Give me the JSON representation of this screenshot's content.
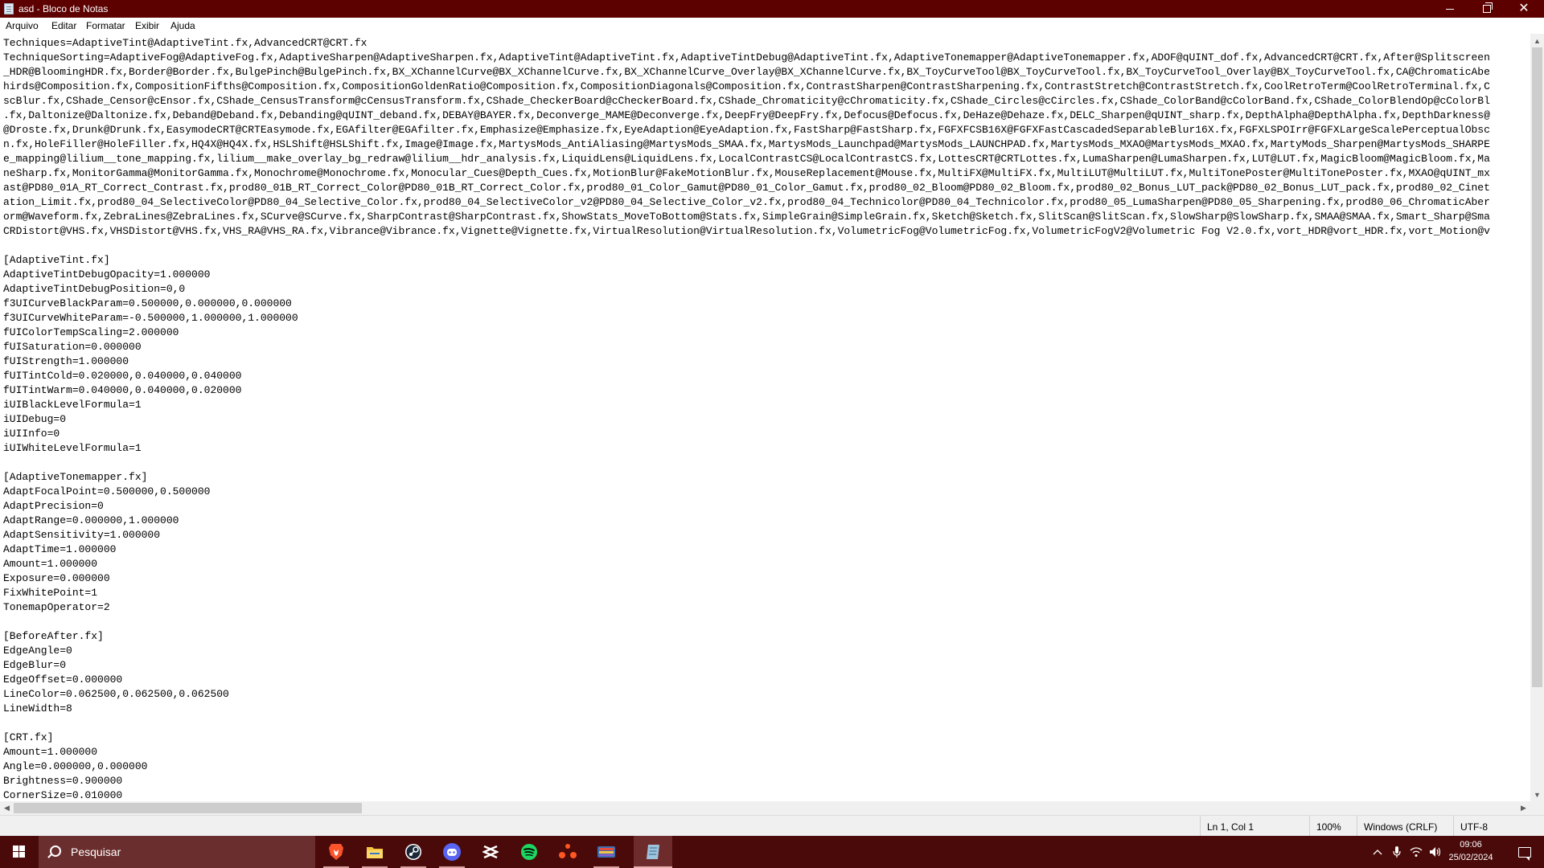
{
  "window": {
    "title": "asd - Bloco de Notas",
    "icon": "notepad-icon",
    "controls": [
      "minimize-icon",
      "maximize-icon",
      "close-icon"
    ]
  },
  "menu": {
    "items": [
      "Arquivo",
      "Editar",
      "Formatar",
      "Exibir",
      "Ajuda"
    ]
  },
  "document": {
    "lines": [
      "Techniques=AdaptiveTint@AdaptiveTint.fx,AdvancedCRT@CRT.fx",
      "TechniqueSorting=AdaptiveFog@AdaptiveFog.fx,AdaptiveSharpen@AdaptiveSharpen.fx,AdaptiveTint@AdaptiveTint.fx,AdaptiveTintDebug@AdaptiveTint.fx,AdaptiveTonemapper@AdaptiveTonemapper.fx,ADOF@qUINT_dof.fx,AdvancedCRT@CRT.fx,After@Splitscreen",
      "_HDR@BloomingHDR.fx,Border@Border.fx,BulgePinch@BulgePinch.fx,BX_XChannelCurve@BX_XChannelCurve.fx,BX_XChannelCurve_Overlay@BX_XChannelCurve.fx,BX_ToyCurveTool@BX_ToyCurveTool.fx,BX_ToyCurveTool_Overlay@BX_ToyCurveTool.fx,CA@ChromaticAbe",
      "hirds@Composition.fx,CompositionFifths@Composition.fx,CompositionGoldenRatio@Composition.fx,CompositionDiagonals@Composition.fx,ContrastSharpen@ContrastSharpening.fx,ContrastStretch@ContrastStretch.fx,CoolRetroTerm@CoolRetroTerminal.fx,C",
      "scBlur.fx,CShade_Censor@cEnsor.fx,CShade_CensusTransform@cCensusTransform.fx,CShade_CheckerBoard@cCheckerBoard.fx,CShade_Chromaticity@cChromaticity.fx,CShade_Circles@cCircles.fx,CShade_ColorBand@cColorBand.fx,CShade_ColorBlendOp@cColorBl",
      ".fx,Daltonize@Daltonize.fx,Deband@Deband.fx,Debanding@qUINT_deband.fx,DEBAY@BAYER.fx,Deconverge_MAME@Deconverge.fx,DeepFry@DeepFry.fx,Defocus@Defocus.fx,DeHaze@Dehaze.fx,DELC_Sharpen@qUINT_sharp.fx,DepthAlpha@DepthAlpha.fx,DepthDarkness@",
      "@Droste.fx,Drunk@Drunk.fx,EasymodeCRT@CRTEasymode.fx,EGAfilter@EGAfilter.fx,Emphasize@Emphasize.fx,EyeAdaption@EyeAdaption.fx,FastSharp@FastSharp.fx,FGFXFCSB16X@FGFXFastCascadedSeparableBlur16X.fx,FGFXLSPOIrr@FGFXLargeScalePerceptualObsc",
      "n.fx,HoleFiller@HoleFiller.fx,HQ4X@HQ4X.fx,HSLShift@HSLShift.fx,Image@Image.fx,MartysMods_AntiAliasing@MartysMods_SMAA.fx,MartysMods_Launchpad@MartysMods_LAUNCHPAD.fx,MartysMods_MXAO@MartysMods_MXAO.fx,MartyMods_Sharpen@MartysMods_SHARPE",
      "e_mapping@lilium__tone_mapping.fx,lilium__make_overlay_bg_redraw@lilium__hdr_analysis.fx,LiquidLens@LiquidLens.fx,LocalContrastCS@LocalContrastCS.fx,LottesCRT@CRTLottes.fx,LumaSharpen@LumaSharpen.fx,LUT@LUT.fx,MagicBloom@MagicBloom.fx,Ma",
      "neSharp.fx,MonitorGamma@MonitorGamma.fx,Monochrome@Monochrome.fx,Monocular_Cues@Depth_Cues.fx,MotionBlur@FakeMotionBlur.fx,MouseReplacement@Mouse.fx,MultiFX@MultiFX.fx,MultiLUT@MultiLUT.fx,MultiTonePoster@MultiTonePoster.fx,MXAO@qUINT_mx",
      "ast@PD80_01A_RT_Correct_Contrast.fx,prod80_01B_RT_Correct_Color@PD80_01B_RT_Correct_Color.fx,prod80_01_Color_Gamut@PD80_01_Color_Gamut.fx,prod80_02_Bloom@PD80_02_Bloom.fx,prod80_02_Bonus_LUT_pack@PD80_02_Bonus_LUT_pack.fx,prod80_02_Cinet",
      "ation_Limit.fx,prod80_04_SelectiveColor@PD80_04_Selective_Color.fx,prod80_04_SelectiveColor_v2@PD80_04_Selective_Color_v2.fx,prod80_04_Technicolor@PD80_04_Technicolor.fx,prod80_05_LumaSharpen@PD80_05_Sharpening.fx,prod80_06_ChromaticAber",
      "orm@Waveform.fx,ZebraLines@ZebraLines.fx,SCurve@SCurve.fx,SharpContrast@SharpContrast.fx,ShowStats_MoveToBottom@Stats.fx,SimpleGrain@SimpleGrain.fx,Sketch@Sketch.fx,SlitScan@SlitScan.fx,SlowSharp@SlowSharp.fx,SMAA@SMAA.fx,Smart_Sharp@Sma",
      "CRDistort@VHS.fx,VHSDistort@VHS.fx,VHS_RA@VHS_RA.fx,Vibrance@Vibrance.fx,Vignette@Vignette.fx,VirtualResolution@VirtualResolution.fx,VolumetricFog@VolumetricFog.fx,VolumetricFogV2@Volumetric Fog V2.0.fx,vort_HDR@vort_HDR.fx,vort_Motion@v",
      "",
      "[AdaptiveTint.fx]",
      "AdaptiveTintDebugOpacity=1.000000",
      "AdaptiveTintDebugPosition=0,0",
      "f3UICurveBlackParam=0.500000,0.000000,0.000000",
      "f3UICurveWhiteParam=-0.500000,1.000000,1.000000",
      "fUIColorTempScaling=2.000000",
      "fUISaturation=0.000000",
      "fUIStrength=1.000000",
      "fUITintCold=0.020000,0.040000,0.040000",
      "fUITintWarm=0.040000,0.040000,0.020000",
      "iUIBlackLevelFormula=1",
      "iUIDebug=0",
      "iUIInfo=0",
      "iUIWhiteLevelFormula=1",
      "",
      "[AdaptiveTonemapper.fx]",
      "AdaptFocalPoint=0.500000,0.500000",
      "AdaptPrecision=0",
      "AdaptRange=0.000000,1.000000",
      "AdaptSensitivity=1.000000",
      "AdaptTime=1.000000",
      "Amount=1.000000",
      "Exposure=0.000000",
      "FixWhitePoint=1",
      "TonemapOperator=2",
      "",
      "[BeforeAfter.fx]",
      "EdgeAngle=0",
      "EdgeBlur=0",
      "EdgeOffset=0.000000",
      "LineColor=0.062500,0.062500,0.062500",
      "LineWidth=8",
      "",
      "[CRT.fx]",
      "Amount=1.000000",
      "Angle=0.000000,0.000000",
      "Brightness=0.900000",
      "CornerSize=0.010000"
    ]
  },
  "status": {
    "position": "Ln 1, Col 1",
    "zoom": "100%",
    "line_ending": "Windows (CRLF)",
    "encoding": "UTF-8"
  },
  "taskbar": {
    "search_placeholder": "Pesquisar",
    "start_icon": "windows-start-icon",
    "search_icon": "search-icon",
    "apps": [
      {
        "name": "brave-browser-icon",
        "color": "#fb542b"
      },
      {
        "name": "file-explorer-icon",
        "color": "#f6c342"
      },
      {
        "name": "steam-icon",
        "color": "#1b2838"
      },
      {
        "name": "discord-icon",
        "color": "#5865f2"
      },
      {
        "name": "capcut-icon",
        "color": "#ffffff"
      },
      {
        "name": "spotify-icon",
        "color": "#1ed760"
      },
      {
        "name": "app-dots-icon",
        "color": "#ff5722"
      },
      {
        "name": "game-launcher-icon",
        "color": "#3c6fb5"
      },
      {
        "name": "notepad-icon",
        "color": "#9ec3de"
      }
    ],
    "tray": [
      "chevron-up-icon",
      "microphone-icon",
      "wifi-icon",
      "volume-icon"
    ],
    "time": "09:06",
    "date": "25/02/2024",
    "notification_icon": "notification-icon"
  },
  "colors": {
    "titlebar": "#5c0000",
    "taskbar": "#4a0a0a",
    "searchbox": "#6b2e2e",
    "active_app": "#6e2b2b"
  }
}
